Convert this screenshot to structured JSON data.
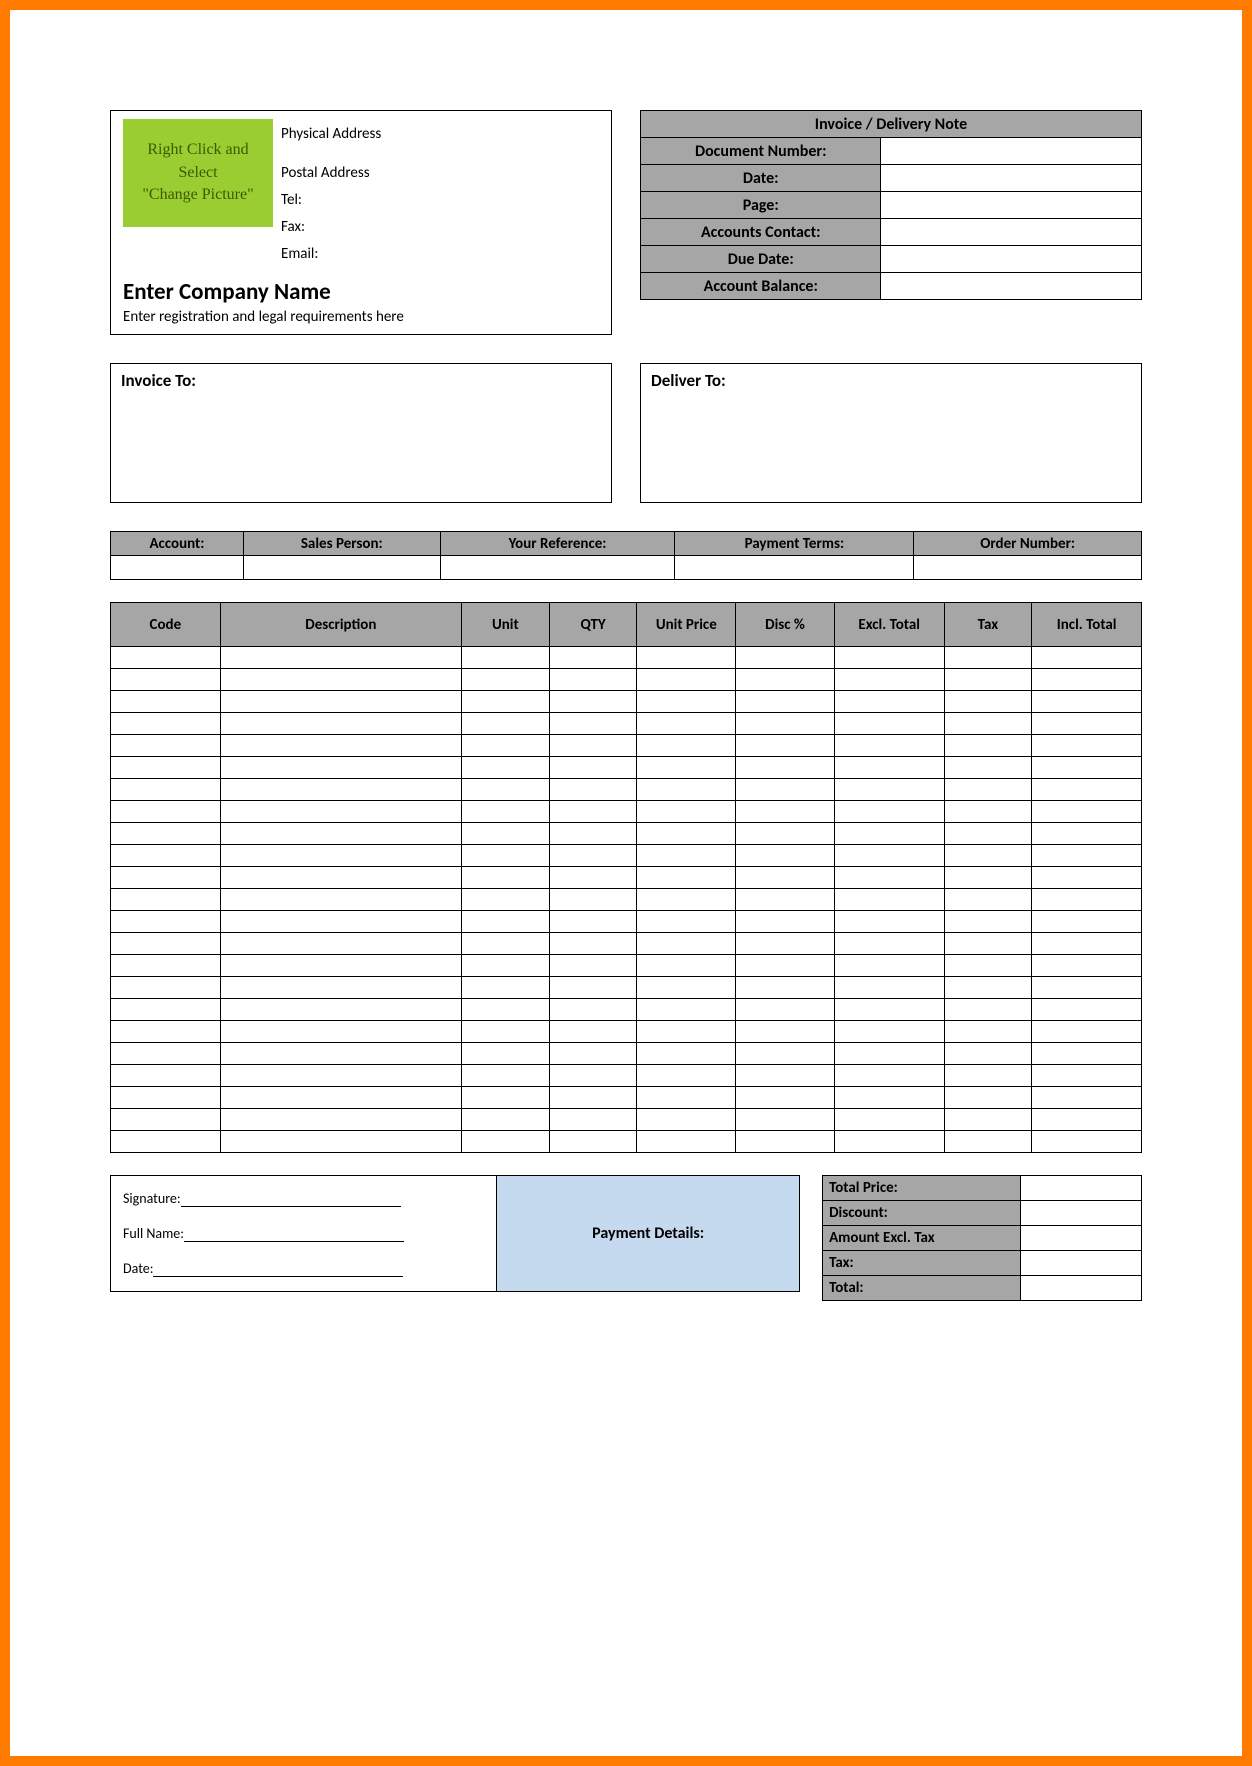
{
  "company": {
    "logo_line1": "Right Click and",
    "logo_line2": "Select",
    "logo_line3": "\"Change Picture\"",
    "physical_address": "Physical Address",
    "postal_address": "Postal Address",
    "tel_label": "Tel:",
    "fax_label": "Fax:",
    "email_label": "Email:",
    "name_placeholder": "Enter Company Name",
    "registration_placeholder": "Enter registration and legal requirements here"
  },
  "doc": {
    "title": "Invoice / Delivery Note",
    "fields": {
      "doc_number_label": "Document Number:",
      "doc_number": "",
      "date_label": "Date:",
      "date": "",
      "page_label": "Page:",
      "page": "",
      "accounts_contact_label": "Accounts Contact:",
      "accounts_contact": "",
      "due_date_label": "Due Date:",
      "due_date": "",
      "account_balance_label": "Account Balance:",
      "account_balance": ""
    }
  },
  "invoice_to_label": "Invoice To:",
  "deliver_to_label": "Deliver To:",
  "meta": {
    "account_label": "Account:",
    "sales_person_label": "Sales Person:",
    "your_reference_label": "Your Reference:",
    "payment_terms_label": "Payment Terms:",
    "order_number_label": "Order Number:"
  },
  "items": {
    "headers": {
      "code": "Code",
      "description": "Description",
      "unit": "Unit",
      "qty": "QTY",
      "unit_price": "Unit Price",
      "disc": "Disc %",
      "excl_total": "Excl. Total",
      "tax": "Tax",
      "incl_total": "Incl. Total"
    },
    "row_count": 23
  },
  "signature": {
    "signature_label": "Signature:",
    "full_name_label": "Full Name:",
    "date_label": "Date:"
  },
  "payment_details_label": "Payment Details:",
  "totals": {
    "total_price_label": "Total Price:",
    "total_price": "",
    "discount_label": "Discount:",
    "discount": "",
    "amount_excl_tax_label": "Amount Excl. Tax",
    "amount_excl_tax": "",
    "tax_label": "Tax:",
    "tax": "",
    "total_label": "Total:",
    "total": ""
  }
}
